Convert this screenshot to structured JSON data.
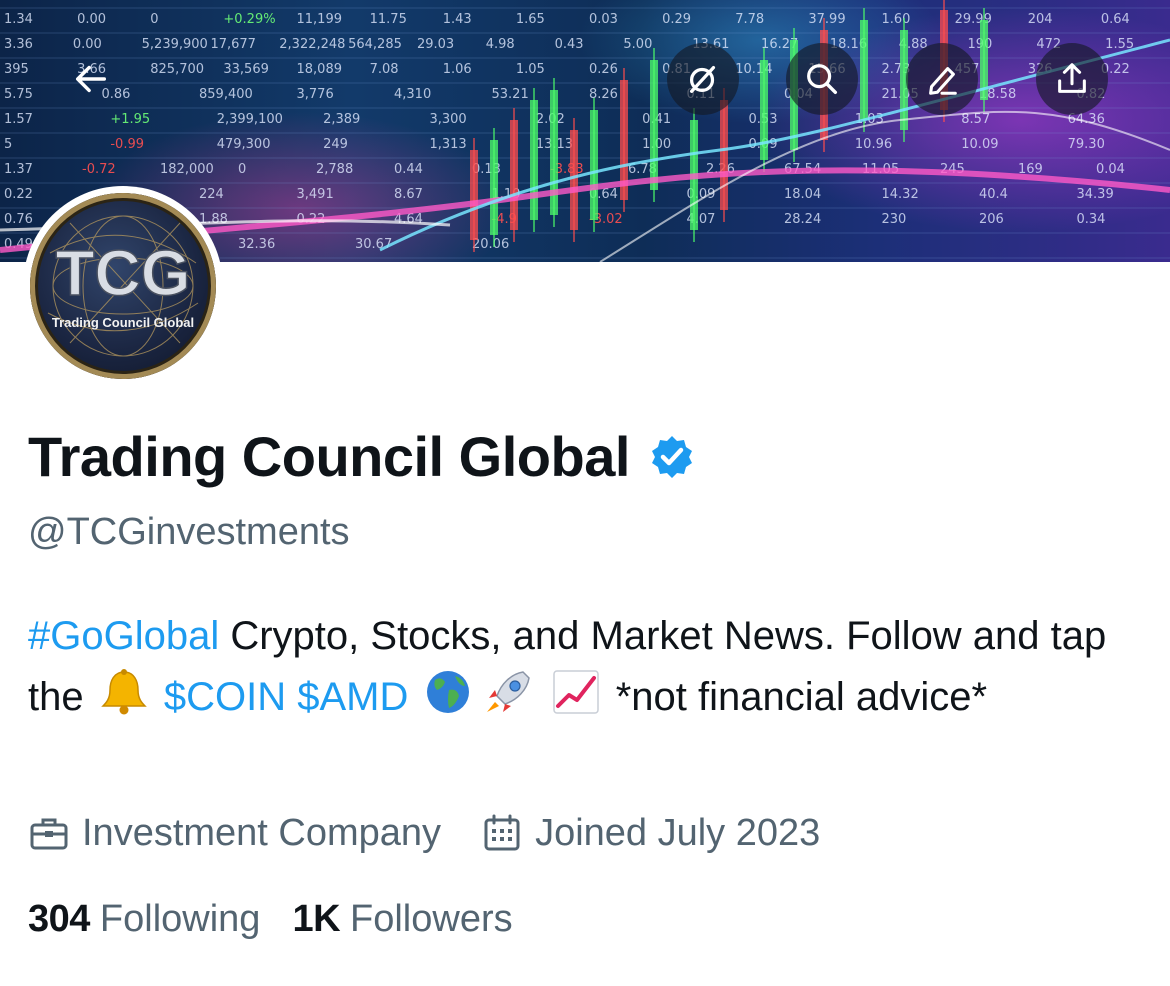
{
  "banner": {
    "ticker_rows": [
      [
        "1.34",
        "0.00",
        "0",
        "+0.29%",
        "11,199",
        "11.75",
        "1.43",
        "1.65",
        "0.03",
        "0.29",
        "7.78",
        "37.99",
        "1.60",
        "29.99",
        "204",
        "0.64"
      ],
      [
        "3.36",
        "0.00",
        "5,239,900",
        "17,677",
        "2,322,248",
        "564,285",
        "29.03",
        "4.98",
        "0.43",
        "5.00",
        "13.61",
        "16.27",
        "18.16",
        "4.88",
        "190",
        "472",
        "1.55"
      ],
      [
        "395",
        "3.66",
        "825,700",
        "33,569",
        "18,089",
        "7.08",
        "1.06",
        "1.05",
        "0.26",
        "0.81",
        "10.14",
        "15.66",
        "2.73",
        "457",
        "326",
        "0.22"
      ],
      [
        "5.75",
        "0.86",
        "859,400",
        "3,776",
        "4,310",
        "53.21",
        "8.26",
        "0.11",
        "0.04",
        "21.05",
        "18.58",
        "0.82"
      ],
      [
        "1.57",
        "+1.95",
        "2,399,100",
        "2,389",
        "3,300",
        "2.02",
        "0.41",
        "0.53",
        "1.03",
        "8.57",
        "64.36"
      ],
      [
        "5",
        "-0.99",
        "479,300",
        "249",
        "1,313",
        "13.13",
        "1.00",
        "0.09",
        "10.96",
        "10.09",
        "79.30"
      ],
      [
        "1.37",
        "-0.72",
        "182,000",
        "0",
        "2,788",
        "0.44",
        "0.13",
        "-3.83",
        "6.78",
        "2.26",
        "67.54",
        "11.05",
        "245",
        "169",
        "0.04"
      ],
      [
        "0.22",
        "0.00",
        "224",
        "3,491",
        "8.67",
        "1.10",
        "0.64",
        "0.09",
        "18.04",
        "14.32",
        "40.4",
        "34.39"
      ],
      [
        "0.76",
        "368",
        "1.88",
        "0.22",
        "4.64",
        "-4.9",
        "-3.02",
        "4.07",
        "28.24",
        "230",
        "206",
        "0.34"
      ],
      [
        "0.49",
        "0.98",
        "32.36",
        "30.67",
        "20.06"
      ]
    ]
  },
  "nav": {
    "back_icon": "back-arrow-icon",
    "grok_icon": "grok-icon",
    "search_icon": "search-icon",
    "edit_icon": "edit-icon",
    "share_icon": "share-icon"
  },
  "avatar": {
    "logo_text": "TCG",
    "logo_subtext": "Trading Council Global"
  },
  "profile": {
    "display_name": "Trading Council Global",
    "verified_icon": "verified-badge-icon",
    "handle": "@TCGinvestments",
    "bio": {
      "hashtag": "#GoGlobal",
      "text1": " Crypto, Stocks, and Market News. Follow and tap the ",
      "bell_icon": "bell-emoji",
      "cashtag1": "$COIN",
      "cashtag2": "$AMD",
      "globe_icon": "globe-emoji",
      "rocket_icon": "rocket-emoji",
      "chart_icon": "chart-increasing-emoji",
      "text2": " *not financial advice*"
    },
    "category": "Investment Company",
    "joined": "Joined July 2023",
    "following_count": "304",
    "following_label": "Following",
    "followers_count": "1K",
    "followers_label": "Followers"
  },
  "colors": {
    "link": "#1d9bf0",
    "secondary_text": "#536471",
    "primary_text": "#0f1419",
    "verified_badge": "#1d9bf0"
  }
}
